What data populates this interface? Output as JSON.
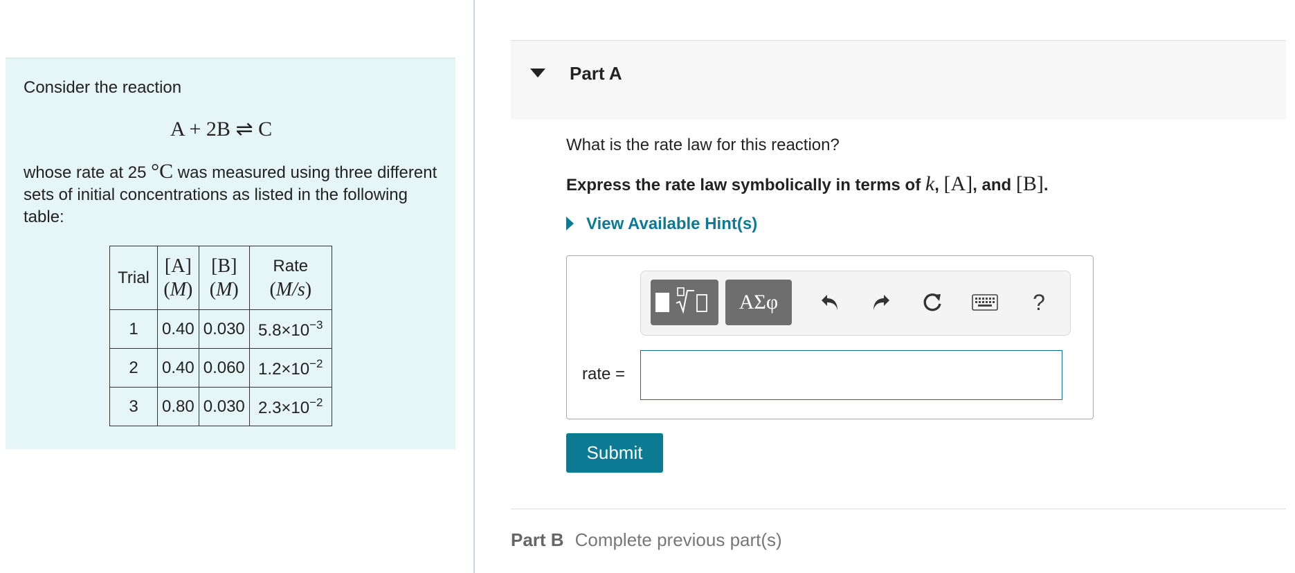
{
  "problem": {
    "intro": "Consider the reaction",
    "reaction": "A + 2B ⇌ C",
    "desc_before": "whose rate at 25 ",
    "desc_temp": "°C",
    "desc_after": " was measured using three different sets of initial concentrations as listed in the following table:",
    "table": {
      "headers": {
        "trial": "Trial",
        "a": "[A]",
        "b": "[B]",
        "unit_m": "M",
        "rate": "Rate",
        "rate_unit": "M/s"
      },
      "rows": [
        {
          "trial": "1",
          "a": "0.40",
          "b": "0.030",
          "rate_base": "5.8×10",
          "rate_exp": "−3"
        },
        {
          "trial": "2",
          "a": "0.40",
          "b": "0.060",
          "rate_base": "1.2×10",
          "rate_exp": "−2"
        },
        {
          "trial": "3",
          "a": "0.80",
          "b": "0.030",
          "rate_base": "2.3×10",
          "rate_exp": "−2"
        }
      ]
    }
  },
  "part_a": {
    "title": "Part A",
    "question": "What is the rate law for this reaction?",
    "instruction_prefix": "Express the rate law symbolically in terms of ",
    "sym_k": "k",
    "sym_a": "[A]",
    "sym_b": "[B]",
    "and_text": "and",
    "hint_label": "View Available Hint(s)",
    "toolbar": {
      "templates_glyph": "√",
      "symbols_label": "ΑΣφ",
      "undo_glyph": "↶",
      "redo_glyph": "↷",
      "reset_glyph": "↻",
      "help_label": "?"
    },
    "answer_label": "rate =",
    "answer_value": "",
    "submit_label": "Submit"
  },
  "part_b": {
    "title": "Part B",
    "status": "Complete previous part(s)"
  },
  "colors": {
    "panel_bg": "#e6f5f6",
    "accent": "#0d7a93",
    "toolbar_button": "#6e6e6e"
  }
}
